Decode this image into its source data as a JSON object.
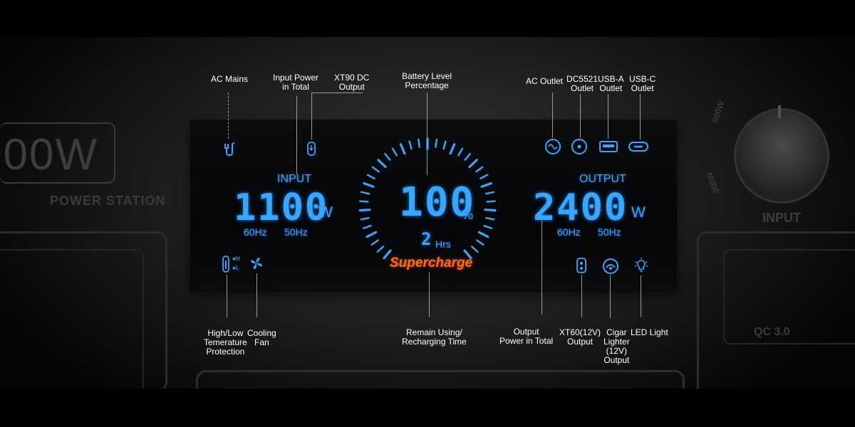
{
  "background": {
    "badge_text": "00W",
    "station_text": "POWER STATION",
    "knob_label": "INPUT",
    "knob_mark_left": "500W",
    "knob_mark_right": "300W",
    "port_label": "QC 3.0"
  },
  "display": {
    "input_label": "INPUT",
    "input_value": "1100",
    "input_unit": "W",
    "input_freq_1": "60Hz",
    "input_freq_2": "50Hz",
    "output_label": "OUTPUT",
    "output_value": "2400",
    "output_unit": "W",
    "output_freq_1": "60Hz",
    "output_freq_2": "50Hz",
    "battery_value": "100",
    "battery_unit": "%",
    "battery_level": 100,
    "time_value": "2",
    "time_unit": "Hrs",
    "mode_text": "Supercharge",
    "temp_high": "H",
    "temp_low": "L"
  },
  "annotations": {
    "ac_mains": "AC Mains",
    "input_power_1": "Input Power",
    "input_power_2": "in Total",
    "xt90_1": "XT90 DC",
    "xt90_2": "Output",
    "battery_1": "Battery Level",
    "battery_2": "Percentage",
    "ac_outlet": "AC Outlet",
    "dc5521_1": "DC5521",
    "dc5521_2": "Outlet",
    "usba_1": "USB-A",
    "usba_2": "Outlet",
    "usbc_1": "USB-C",
    "usbc_2": "Outlet",
    "temp_1": "High/Low",
    "temp_2": "Temerature",
    "temp_3": "Protection",
    "fan_1": "Cooling",
    "fan_2": "Fan",
    "remain_1": "Remain Using/",
    "remain_2": "Recharging Time",
    "outpower_1": "Output",
    "outpower_2": "Power in Total",
    "xt60_1": "XT60(12V)",
    "xt60_2": "Output",
    "cigar_1": "Cigar",
    "cigar_2": "Lighter",
    "cigar_3": "(12V)",
    "cigar_4": "Output",
    "led": "LED Light"
  },
  "colors": {
    "lcd_blue": "#36a6ff",
    "supercharge_orange": "#ff6a1a"
  },
  "icons": [
    "ac-mains-icon",
    "xt90-icon",
    "ac-outlet-icon",
    "dc5521-icon",
    "usb-a-icon",
    "usb-c-icon",
    "thermometer-icon",
    "fan-icon",
    "xt60-icon",
    "cigar-lighter-icon",
    "led-light-icon"
  ]
}
